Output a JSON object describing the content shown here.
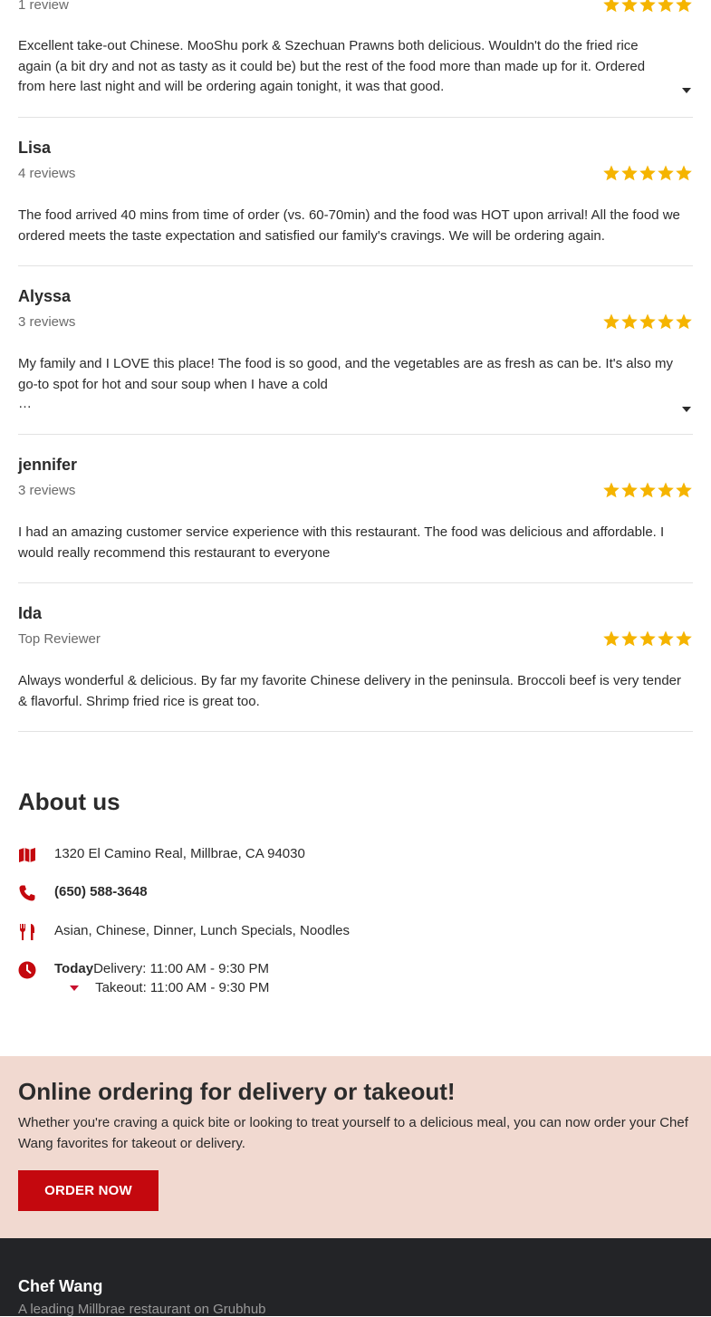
{
  "reviews": [
    {
      "name": "",
      "count": "1 review",
      "rating": 5,
      "text": "Excellent take-out Chinese. MooShu pork & Szechuan Prawns both delicious. Wouldn't do the fried rice again (a bit dry and not as tasty as it could be) but the rest of the food more than made up for it. Ordered from here last night and will be ordering again tonight, it was that good."
    },
    {
      "name": "Lisa",
      "count": "4 reviews",
      "rating": 5,
      "text": "The food arrived 40 mins from time of order (vs. 60-70min) and the food was HOT upon arrival! All the food we ordered meets the taste expectation and satisfied our family's cravings. We will be ordering again."
    },
    {
      "name": "Alyssa",
      "count": "3 reviews",
      "rating": 5,
      "text": "My family and I LOVE this place! The food is so good, and the vegetables are as fresh as can be. It's also my go-to spot for hot and sour soup when I have a cold",
      "ellipsis": "…"
    },
    {
      "name": "jennifer",
      "count": "3 reviews",
      "rating": 5,
      "text": "I had an amazing customer service experience with this restaurant. The food was delicious and affordable. I would really recommend this restaurant to everyone"
    },
    {
      "name": "Ida",
      "count": "Top Reviewer",
      "rating": 5,
      "text": "Always wonderful & delicious. By far my favorite Chinese delivery in the peninsula. Broccoli beef is very tender & flavorful. Shrimp fried rice is great too."
    }
  ],
  "about": {
    "title": "About us",
    "address": "1320 El Camino Real, Millbrae, CA 94030",
    "phone": "(650) 588-3648",
    "cuisines": "Asian, Chinese, Dinner, Lunch Specials, Noodles",
    "hours": {
      "today_label": "Today",
      "delivery": "Delivery: 11:00 AM - 9:30 PM",
      "takeout": "Takeout: 11:00 AM - 9:30 PM"
    },
    "icons": [
      "map-icon",
      "phone-icon",
      "utensils-icon",
      "clock-icon"
    ]
  },
  "promo": {
    "title": "Online ordering for delivery or takeout!",
    "text": "Whether you're craving a quick bite or looking to treat yourself to a delicious meal, you can now order your Chef Wang favorites for takeout or delivery.",
    "button": "ORDER NOW"
  },
  "footer": {
    "brand": "Chef Wang",
    "tagline": "A leading Millbrae restaurant on Grubhub"
  },
  "colors": {
    "accent": "#c4080e",
    "star": "#f5b400",
    "promo_bg": "#f1d9d0",
    "footer_bg": "#232427"
  }
}
